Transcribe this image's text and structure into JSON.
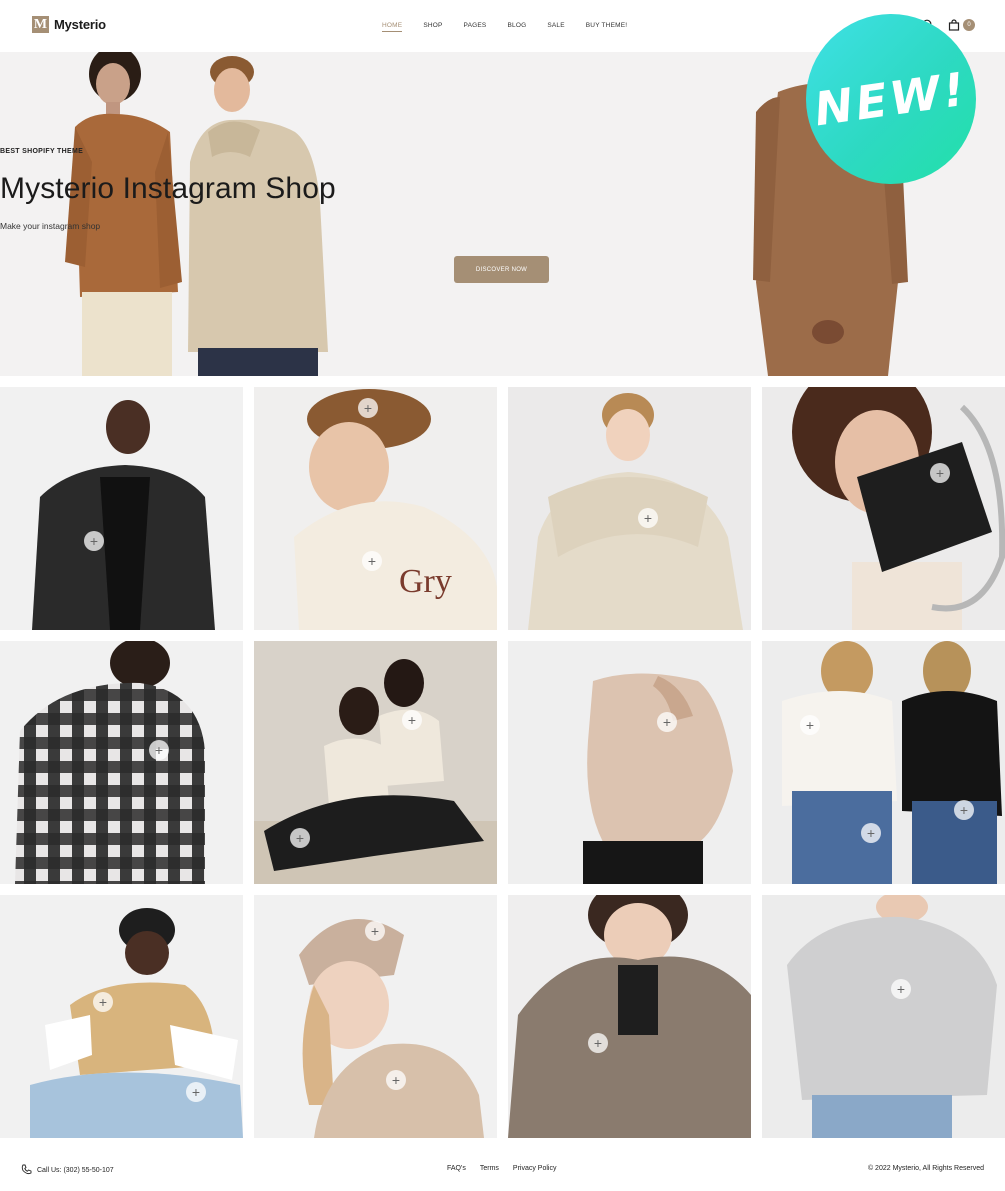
{
  "header": {
    "logo_letter": "M",
    "logo_text": "Mysterio",
    "nav": [
      "HOME",
      "SHOP",
      "PAGES",
      "BLOG",
      "SALE",
      "BUY THEME!"
    ],
    "active_nav": "HOME",
    "cart_count": "0"
  },
  "hero": {
    "eyebrow": "BEST SHOPIFY THEME",
    "title": "Mysterio Instagram Shop",
    "subtitle": "Make your instagram shop",
    "button": "DISCOVER NOW"
  },
  "badge": {
    "text": "NEW!"
  },
  "grid": {
    "tiles": [
      {
        "subject": "man-leather-jacket"
      },
      {
        "subject": "man-cap-hoodie"
      },
      {
        "subject": "man-cream-tee"
      },
      {
        "subject": "woman-black-bag"
      },
      {
        "subject": "man-plaid-shirt"
      },
      {
        "subject": "two-women-sitting"
      },
      {
        "subject": "woman-knit-sweater"
      },
      {
        "subject": "two-women-turtlenecks"
      },
      {
        "subject": "man-beanie-sitting"
      },
      {
        "subject": "woman-beanie-hoodie"
      },
      {
        "subject": "woman-wool-coat"
      },
      {
        "subject": "man-grey-sweatshirt"
      }
    ],
    "plus_symbol": "+"
  },
  "footer": {
    "phone": "Call Us: (302) 55-50-107",
    "links": [
      "FAQ's",
      "Terms",
      "Privacy Policy"
    ],
    "copyright": "© 2022 Mysterio, All Rights Reserved"
  },
  "colors": {
    "accent": "#a58f75",
    "hero_bg": "#f3f2f2",
    "badge_start": "#3fe0e6",
    "badge_end": "#22e0a8"
  }
}
